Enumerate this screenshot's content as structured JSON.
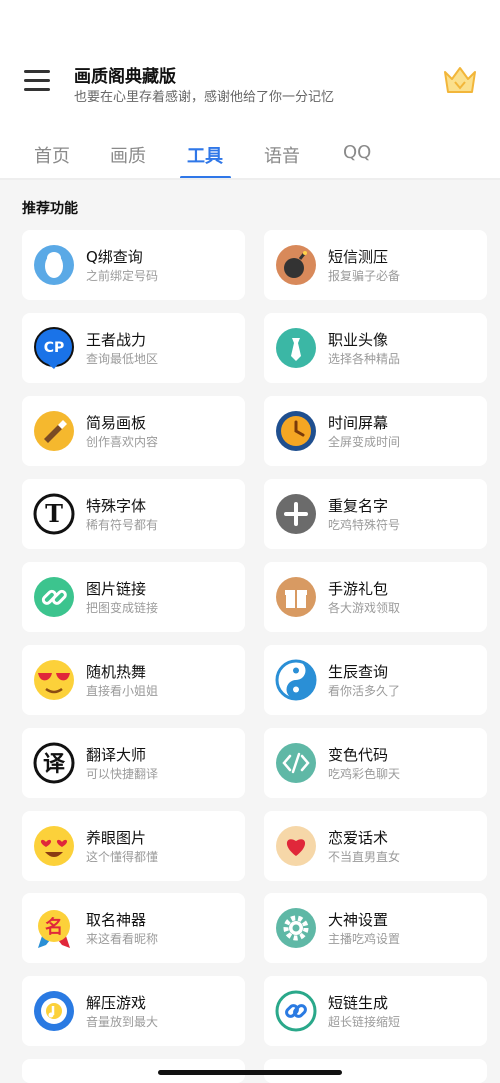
{
  "header": {
    "title": "画质阁典藏版",
    "subtitle": "也要在心里存着感谢，感谢他给了你一分记忆"
  },
  "tabs": [
    {
      "label": "首页",
      "active": false
    },
    {
      "label": "画质",
      "active": false
    },
    {
      "label": "工具",
      "active": true
    },
    {
      "label": "语音",
      "active": false
    },
    {
      "label": "QQ",
      "active": false
    }
  ],
  "section": {
    "title": "推荐功能"
  },
  "features": [
    {
      "title": "Q绑查询",
      "sub": "之前绑定号码",
      "icon": "qq-penguin-icon"
    },
    {
      "title": "短信测压",
      "sub": "报复骗子必备",
      "icon": "bomb-icon"
    },
    {
      "title": "王者战力",
      "sub": "查询最低地区",
      "icon": "cp-badge-icon"
    },
    {
      "title": "职业头像",
      "sub": "选择各种精品",
      "icon": "tie-icon"
    },
    {
      "title": "简易画板",
      "sub": "创作喜欢内容",
      "icon": "brush-icon"
    },
    {
      "title": "时间屏幕",
      "sub": "全屏变成时间",
      "icon": "clock-icon"
    },
    {
      "title": "特殊字体",
      "sub": "稀有符号都有",
      "icon": "font-t-icon"
    },
    {
      "title": "重复名字",
      "sub": "吃鸡特殊符号",
      "icon": "plus-icon"
    },
    {
      "title": "图片链接",
      "sub": "把图变成链接",
      "icon": "link-icon"
    },
    {
      "title": "手游礼包",
      "sub": "各大游戏领取",
      "icon": "gift-icon"
    },
    {
      "title": "随机热舞",
      "sub": "直接看小姐姐",
      "icon": "sunglasses-emoji-icon"
    },
    {
      "title": "生辰查询",
      "sub": "看你活多久了",
      "icon": "yin-yang-icon"
    },
    {
      "title": "翻译大师",
      "sub": "可以快捷翻译",
      "icon": "translate-icon"
    },
    {
      "title": "变色代码",
      "sub": "吃鸡彩色聊天",
      "icon": "code-icon"
    },
    {
      "title": "养眼图片",
      "sub": "这个懂得都懂",
      "icon": "heart-eyes-emoji-icon"
    },
    {
      "title": "恋爱话术",
      "sub": "不当直男直女",
      "icon": "heart-icon"
    },
    {
      "title": "取名神器",
      "sub": "来这看看昵称",
      "icon": "name-medal-icon"
    },
    {
      "title": "大神设置",
      "sub": "主播吃鸡设置",
      "icon": "gear-icon"
    },
    {
      "title": "解压游戏",
      "sub": "音量放到最大",
      "icon": "music-disc-icon"
    },
    {
      "title": "短链生成",
      "sub": "超长链接缩短",
      "icon": "short-link-icon"
    }
  ],
  "colors": {
    "accent": "#2f77e8",
    "background": "#f5f5f5",
    "card": "#ffffff",
    "crown": "#f2b63a"
  },
  "icons": {
    "menu": "menu-icon",
    "crown": "crown-icon"
  }
}
